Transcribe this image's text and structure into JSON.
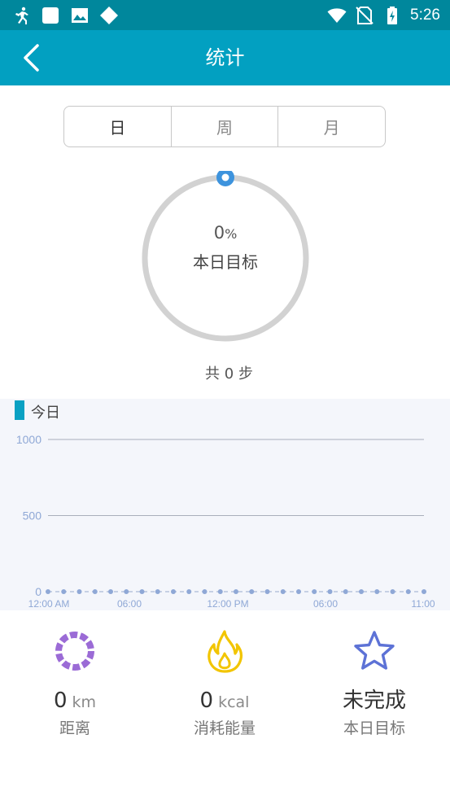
{
  "status_bar": {
    "time": "5:26",
    "left_icons": [
      "running-icon",
      "square-icon",
      "image-icon",
      "diamond-icon"
    ],
    "right_icons": [
      "wifi-icon",
      "no-sim-icon",
      "battery-charging-icon"
    ]
  },
  "app_bar": {
    "title": "统计",
    "back_icon": "back-arrow-icon"
  },
  "tabs": [
    {
      "label": "日",
      "selected": true
    },
    {
      "label": "周",
      "selected": false
    },
    {
      "label": "月",
      "selected": false
    }
  ],
  "goal_ring": {
    "percent": "0",
    "percent_sign": "%",
    "label": "本日目标",
    "progress_fraction": 0
  },
  "total_steps": "共 0 步",
  "chart": {
    "legend": "今日",
    "chart_data": {
      "type": "line",
      "title": "",
      "legend": [
        "今日"
      ],
      "y_ticks": [
        "1000",
        "500",
        "0"
      ],
      "ylim": [
        0,
        1000
      ],
      "x_tick_labels": [
        "12:00 AM",
        "06:00",
        "12:00 PM",
        "06:00",
        "11:00"
      ],
      "series": [
        {
          "name": "今日",
          "values": [
            0,
            0,
            0,
            0,
            0,
            0,
            0,
            0,
            0,
            0,
            0,
            0,
            0,
            0,
            0,
            0,
            0,
            0,
            0,
            0,
            0,
            0,
            0,
            0,
            0
          ]
        }
      ],
      "grid": true,
      "colors": {
        "line": "#b7c4dd",
        "point": "#8fa8d6",
        "tick_text": "#8fa8d6"
      }
    }
  },
  "stats": [
    {
      "value": "0",
      "unit": "km",
      "label": "距离",
      "icon": "distance-ring-icon",
      "color": "#9b6bd6"
    },
    {
      "value": "0",
      "unit": "kcal",
      "label": "消耗能量",
      "icon": "flame-icon",
      "color": "#f2c500"
    },
    {
      "value": "未完成",
      "unit": "",
      "label": "本日目标",
      "icon": "star-icon",
      "color": "#5d72d6"
    }
  ],
  "colors": {
    "status_bar": "#00879c",
    "app_bar": "#02a0c1",
    "ring_track": "#d2d2d2",
    "ring_knob": "#3d93dd"
  }
}
